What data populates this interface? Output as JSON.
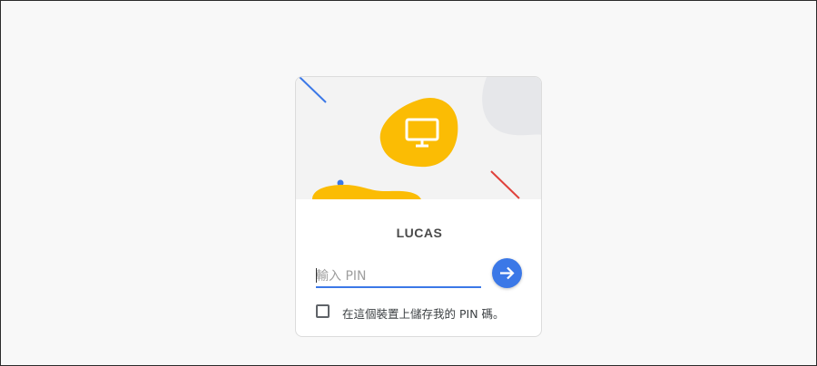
{
  "user": {
    "name": "LUCAS",
    "avatar_icon": "monitor-icon"
  },
  "pin": {
    "placeholder": "輸入 PIN",
    "value": ""
  },
  "submit": {
    "icon": "arrow-right-icon"
  },
  "remember": {
    "checked": false,
    "label": "在這個裝置上儲存我的 PIN 碼。"
  },
  "colors": {
    "accent": "#3b78e7",
    "brand_yellow": "#fbbc04",
    "red_line": "#e0413b",
    "blue_line": "#3b78e7"
  }
}
